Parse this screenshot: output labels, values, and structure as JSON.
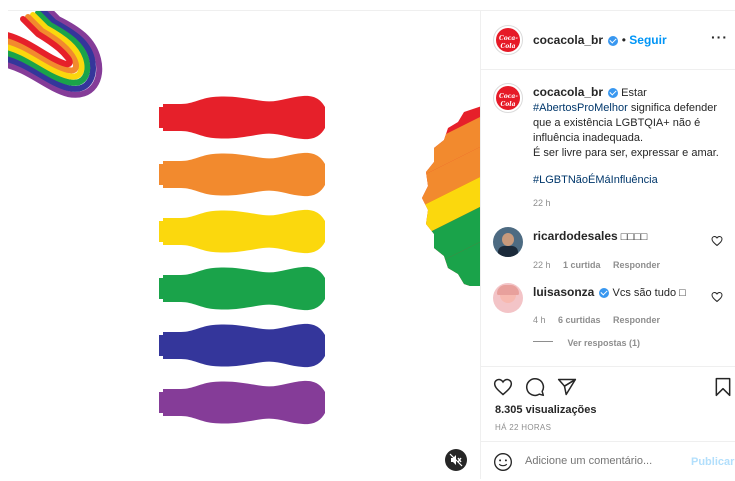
{
  "post": {
    "username": "cocacola_br",
    "follow_label": "Seguir",
    "separator": "•",
    "more_label": "···",
    "caption_start": "Estar",
    "caption_hashtag1": "#AbertosProMelhor",
    "caption_rest": "significa defender que a existência LGBTQIA+ não é influência inadequada.",
    "caption_line2": "É ser livre para ser, expressar e amar.",
    "caption_hashtag2": "#LGBTNãoÉMáInfluência",
    "caption_time": "22 h",
    "views": "8.305 visualizações",
    "date": "HÁ 22 HORAS",
    "add_comment_placeholder": "Adicione um comentário...",
    "publish_label": "Publicar",
    "logo_text": "Coca-Cola"
  },
  "comments": [
    {
      "username": "ricardodesales",
      "text": "□□□□",
      "time": "22 h",
      "likes": "1 curtida",
      "reply": "Responder"
    },
    {
      "username": "luisasonza",
      "text": "Vcs são tudo □",
      "time": "4 h",
      "likes": "6 curtidas",
      "reply": "Responder",
      "verified": true
    }
  ],
  "view_replies": "Ver respostas (1)",
  "colors": {
    "bottle_red": "#e6202a",
    "bottle_orange": "#f28a2e",
    "bottle_yellow": "#fbd80d",
    "bottle_green": "#1aa34a",
    "bottle_blue": "#34369b",
    "bottle_purple": "#853c98",
    "accent": "#0095f6"
  }
}
